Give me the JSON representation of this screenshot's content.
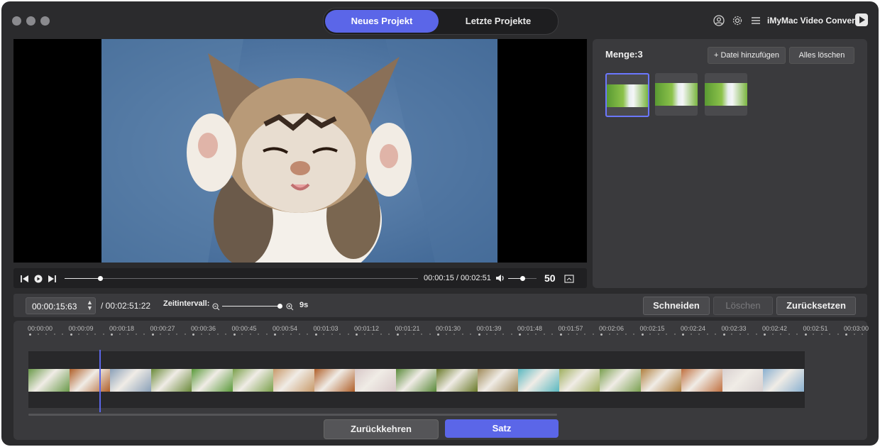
{
  "header": {
    "tabs": [
      {
        "label": "Neues Projekt",
        "active": true
      },
      {
        "label": "Letzte Projekte",
        "active": false
      }
    ],
    "brand": "iMyMac Video Converter",
    "icons": [
      "user-icon",
      "gear-icon",
      "menu-icon"
    ]
  },
  "player": {
    "time": "00:00:15 / 00:02:51",
    "volume": "50",
    "progress": 0.1,
    "volume_level": 0.5
  },
  "media_panel": {
    "count_label": "Menge:3",
    "add_button": "+ Datei hinzufügen",
    "clear_button": "Alles löschen",
    "thumbnails": 3
  },
  "trim": {
    "current_time": "00:00:15:63",
    "total_time": "/ 00:02:51:22",
    "interval_label": "Zeitintervall:",
    "interval_value": "9s",
    "cut_button": "Schneiden",
    "delete_button": "Löschen",
    "reset_button": "Zurücksetzen"
  },
  "timeline": {
    "ticks": [
      "00:00:00",
      "00:00:09",
      "00:00:18",
      "00:00:27",
      "00:00:36",
      "00:00:45",
      "00:00:54",
      "00:01:03",
      "00:01:12",
      "00:01:21",
      "00:01:30",
      "00:01:39",
      "00:01:48",
      "00:01:57",
      "00:02:06",
      "00:02:15",
      "00:02:24",
      "00:02:33",
      "00:02:42",
      "00:02:51",
      "00:03:00"
    ],
    "frame_colors": [
      "#6a9a4a",
      "#b0602a",
      "#8aa0b8",
      "#6a8a3a",
      "#5a9a3a",
      "#7aa04a",
      "#c89a6a",
      "#b0602a",
      "#d8c8c8",
      "#5a8a3a",
      "#6a7a2a",
      "#a08a5a",
      "#5ab8c0",
      "#a0b060",
      "#7aa050",
      "#b08040",
      "#c07040",
      "#d8d0d0",
      "#8ab0d0"
    ]
  },
  "footer": {
    "back_button": "Zurückkehren",
    "apply_button": "Satz"
  },
  "colors": {
    "accent": "#5b66e8",
    "background": "#2b2b2d",
    "panel": "#3a3a3d"
  }
}
